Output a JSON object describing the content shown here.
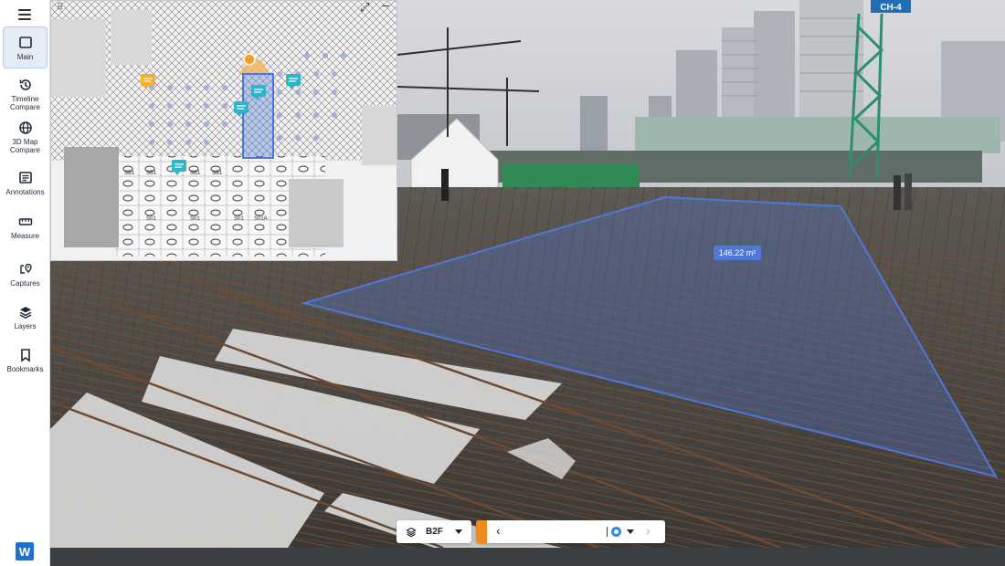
{
  "sidebar": {
    "items": [
      {
        "label": "Main",
        "icon": "square-icon"
      },
      {
        "label": "Timeline Compare",
        "icon": "history-icon"
      },
      {
        "label": "3D Map Compare",
        "icon": "globe-icon"
      },
      {
        "label": "Annotations",
        "icon": "annotation-icon"
      },
      {
        "label": "Measure",
        "icon": "ruler-icon"
      },
      {
        "label": "Captures",
        "icon": "capture-pin-icon"
      },
      {
        "label": "Layers",
        "icon": "layers-icon"
      },
      {
        "label": "Bookmarks",
        "icon": "bookmark-icon"
      }
    ],
    "brand_letter": "W"
  },
  "viewer": {
    "area_label": "146.22 m²",
    "crane_sign": "CH-4"
  },
  "minimap": {
    "drag_glyph": "⠿",
    "expand_glyph": "⤢",
    "minimize_glyph": "–",
    "labels": [
      "SB1",
      "SB1",
      "SB1",
      "SB1",
      "S01",
      "S01",
      "S01",
      "S01A"
    ]
  },
  "controls": {
    "floor": "B2F",
    "prev_glyph": "‹",
    "next_glyph": "›"
  },
  "colors": {
    "accent": "#2a8df2",
    "handle": "#f08a1d",
    "area_fill": "#4f77d6",
    "marker": "#2bb7c9",
    "marker_yellow": "#f2b02a"
  }
}
